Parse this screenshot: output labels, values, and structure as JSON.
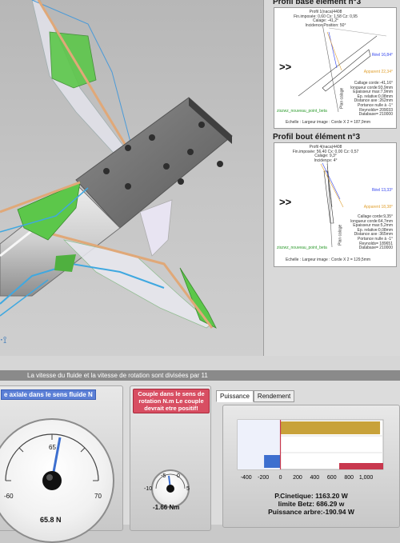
{
  "profile_base": {
    "title": "Profil base élément n°3",
    "header": [
      "Profil 1(naca)4408",
      "Fin.imposée: 0,60 Cx: 1,58 Cz: 0,95",
      "Calage: -41,2°",
      "Incidence Position: 50°"
    ],
    "arrows": ">>",
    "reel": "Réel 16,84°",
    "apparent": "Apparent 22,34°",
    "details": [
      "Callage corde:-41,16°",
      "longueur corde:93,9mm",
      "Epaisseur max:7,9mm",
      "Ep. relative:0,08mm",
      "Distance axe :262mm",
      "Portance nulle à -1°",
      "Reynolds= 209033",
      "Database= 210000"
    ],
    "side_label": "Plan calage",
    "green_label": "ziszwz_nouveau_point_beta",
    "footer": "Echelle : Largeur image : Corde X 2 = 187,9mm"
  },
  "profile_tip": {
    "title": "Profil bout élément n°3",
    "header": [
      "Profil 4(naca)4408",
      "Fin.imposée: 56,40 Cx: 0,00 Cz: 0,57",
      "Calage: 9,3°",
      "Incidence: 4°"
    ],
    "arrows": ">>",
    "reel": "Réel 13,33°",
    "apparent": "Apparent 18,38°",
    "details": [
      "Callage corde:9,35°",
      "longueur corde:64,7mm",
      "Epaisseur max:5,2mm",
      "Ep. relative:0,08mm",
      "Distance axe :365mm",
      "Portance nulle à -1°",
      "Reynolds= 189651",
      "Database= 210000"
    ],
    "side_label": "Plan calage",
    "green_label": "ziszwz_nouveau_point_beta",
    "footer": "Echelle : Largeur image : Corde X 2 = 129,5mm"
  },
  "status": {
    "message": "La vitesse du fluide et la vitesse de rotation sont divisées par 11"
  },
  "axial_force": {
    "title": "e axiale dans le sens fluide N",
    "ticks": [
      "-60",
      "65",
      "70"
    ],
    "value": "65.8 N"
  },
  "torque": {
    "title": "Couple dans le sens de rotation N.m Le couple devrait etre positif!",
    "ticks": [
      "-10",
      "-5",
      "0",
      "5"
    ],
    "value": "-1.66 Nm"
  },
  "power": {
    "tabs": [
      "Puissance",
      "Rendement"
    ],
    "axis_ticks": [
      "-400",
      "-200",
      "0",
      "200",
      "400",
      "600",
      "800",
      "1,000"
    ],
    "kinetic": "P.Cinetique: 1163.20 W",
    "betz": "limite Betz: 686.29 w",
    "shaft": "Puissance arbre:-190.94 W",
    "bars": {
      "kinetic_w": 1163.2,
      "betz_w": 686.29,
      "shaft_w": -190.94
    },
    "colors": {
      "kinetic": "#c8a23a",
      "shaft": "#3d6fcf",
      "betz": "#c8384e",
      "negative_zone": "#f3c6cc"
    }
  }
}
